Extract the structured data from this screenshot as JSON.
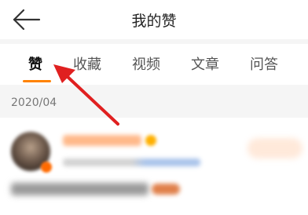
{
  "header": {
    "title": "我的赞",
    "back_icon": "arrow-left-icon"
  },
  "tabs": [
    {
      "label": "赞",
      "active": true
    },
    {
      "label": "收藏",
      "active": false
    },
    {
      "label": "视频",
      "active": false
    },
    {
      "label": "文章",
      "active": false
    },
    {
      "label": "问答",
      "active": false
    }
  ],
  "feed": {
    "date": "2020/04"
  },
  "colors": {
    "accent": "#ff8200",
    "annotation_arrow": "#e02020"
  }
}
